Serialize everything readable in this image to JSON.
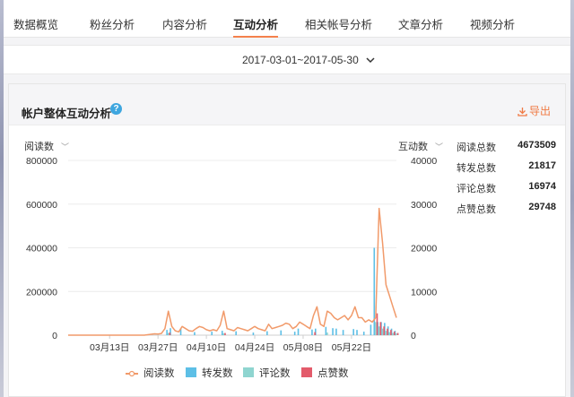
{
  "nav": {
    "tabs": [
      {
        "label": "数据概览"
      },
      {
        "label": "粉丝分析"
      },
      {
        "label": "内容分析"
      },
      {
        "label": "互动分析"
      },
      {
        "label": "相关帐号分析"
      },
      {
        "label": "文章分析"
      },
      {
        "label": "视频分析"
      }
    ],
    "active": "互动分析"
  },
  "date_range": "2017-03-01~2017-05-30",
  "panel": {
    "title": "帐户整体互动分析",
    "export_label": "导出"
  },
  "selectors": {
    "left": "阅读数",
    "right": "互动数"
  },
  "stats": [
    {
      "label": "阅读总数",
      "value": "4673509"
    },
    {
      "label": "转发总数",
      "value": "21817"
    },
    {
      "label": "评论总数",
      "value": "16974"
    },
    {
      "label": "点赞总数",
      "value": "29748"
    }
  ],
  "colors": {
    "read": "#f19a6a",
    "share": "#5dbfe6",
    "comment": "#8fd5d0",
    "like": "#e35b6b",
    "accent": "#f4814c"
  },
  "chart_data": {
    "type": "line",
    "x_ticks": [
      "03月13日",
      "03月27日",
      "04月10日",
      "04月24日",
      "05月08日",
      "05月22日"
    ],
    "y_left": {
      "label": "阅读数",
      "ticks": [
        "800000",
        "600000",
        "400000",
        "200000",
        "0"
      ],
      "ylim": [
        0,
        800000
      ]
    },
    "y_right": {
      "label": "互动数",
      "ticks": [
        "40000",
        "30000",
        "20000",
        "10000",
        "0"
      ],
      "ylim": [
        0,
        40000
      ]
    },
    "x_start": "2017-03-01",
    "x_end": "2017-05-30",
    "series": [
      {
        "name": "阅读数",
        "type": "line",
        "axis": "left",
        "values": [
          0,
          0,
          0,
          0,
          0,
          0,
          0,
          0,
          0,
          0,
          0,
          0,
          0,
          0,
          0,
          0,
          0,
          0,
          0,
          0,
          0,
          0,
          0,
          2000,
          4000,
          6000,
          5000,
          8000,
          30000,
          110000,
          40000,
          20000,
          15000,
          40000,
          30000,
          20000,
          18000,
          30000,
          40000,
          35000,
          25000,
          20000,
          25000,
          20000,
          45000,
          110000,
          30000,
          25000,
          20000,
          35000,
          30000,
          25000,
          20000,
          30000,
          40000,
          30000,
          25000,
          20000,
          50000,
          30000,
          35000,
          40000,
          45000,
          55000,
          50000,
          30000,
          40000,
          60000,
          50000,
          40000,
          30000,
          90000,
          130000,
          50000,
          40000,
          110000,
          100000,
          80000,
          70000,
          80000,
          90000,
          70000,
          90000,
          130000,
          80000,
          80000,
          60000,
          70000,
          60000,
          80000,
          580000,
          420000,
          230000,
          180000,
          130000,
          80000
        ]
      },
      {
        "name": "转发数",
        "type": "bar",
        "axis": "right",
        "values": [
          0,
          0,
          0,
          0,
          0,
          0,
          0,
          0,
          0,
          0,
          0,
          0,
          0,
          0,
          0,
          0,
          0,
          0,
          0,
          0,
          0,
          0,
          0,
          0,
          0,
          0,
          0,
          0,
          0,
          1200,
          1600,
          0,
          0,
          1500,
          0,
          0,
          0,
          700,
          0,
          0,
          0,
          0,
          800,
          0,
          0,
          1000,
          0,
          0,
          0,
          900,
          0,
          0,
          0,
          0,
          600,
          0,
          0,
          0,
          900,
          0,
          0,
          0,
          1100,
          0,
          0,
          0,
          800,
          1500,
          0,
          0,
          0,
          1300,
          1500,
          0,
          0,
          1900,
          0,
          1600,
          1500,
          0,
          1200,
          0,
          0,
          1400,
          1200,
          0,
          800,
          0,
          2400,
          20000,
          3000,
          3000,
          2800,
          2000,
          1500,
          1000
        ]
      },
      {
        "name": "评论数",
        "type": "bar",
        "axis": "right",
        "values": [
          0,
          0,
          0,
          0,
          0,
          0,
          0,
          0,
          0,
          0,
          0,
          0,
          0,
          0,
          0,
          0,
          0,
          0,
          0,
          0,
          0,
          0,
          0,
          0,
          0,
          0,
          0,
          0,
          0,
          500,
          0,
          0,
          0,
          0,
          0,
          0,
          0,
          0,
          0,
          0,
          0,
          0,
          0,
          0,
          0,
          400,
          0,
          0,
          0,
          0,
          0,
          0,
          0,
          0,
          0,
          0,
          0,
          0,
          0,
          0,
          0,
          0,
          0,
          0,
          0,
          0,
          0,
          0,
          0,
          0,
          0,
          0,
          0,
          0,
          0,
          600,
          0,
          0,
          0,
          0,
          0,
          0,
          0,
          0,
          0,
          0,
          0,
          0,
          0,
          3000,
          2000,
          1500,
          1000,
          700,
          500,
          400
        ]
      },
      {
        "name": "点赞数",
        "type": "bar",
        "axis": "right",
        "values": [
          0,
          0,
          0,
          0,
          0,
          0,
          0,
          0,
          0,
          0,
          0,
          0,
          0,
          0,
          0,
          0,
          0,
          0,
          0,
          0,
          0,
          0,
          0,
          0,
          0,
          0,
          0,
          0,
          0,
          600,
          0,
          0,
          0,
          0,
          0,
          0,
          0,
          0,
          0,
          0,
          0,
          0,
          0,
          0,
          0,
          500,
          0,
          0,
          0,
          0,
          0,
          0,
          0,
          0,
          0,
          0,
          0,
          0,
          0,
          0,
          0,
          0,
          0,
          0,
          0,
          0,
          0,
          0,
          0,
          0,
          0,
          700,
          0,
          0,
          0,
          0,
          0,
          0,
          0,
          0,
          0,
          0,
          0,
          0,
          0,
          0,
          0,
          0,
          0,
          5000,
          3000,
          2000,
          1500,
          1200,
          800,
          500
        ]
      }
    ],
    "grid": true,
    "legend": "bottom"
  }
}
